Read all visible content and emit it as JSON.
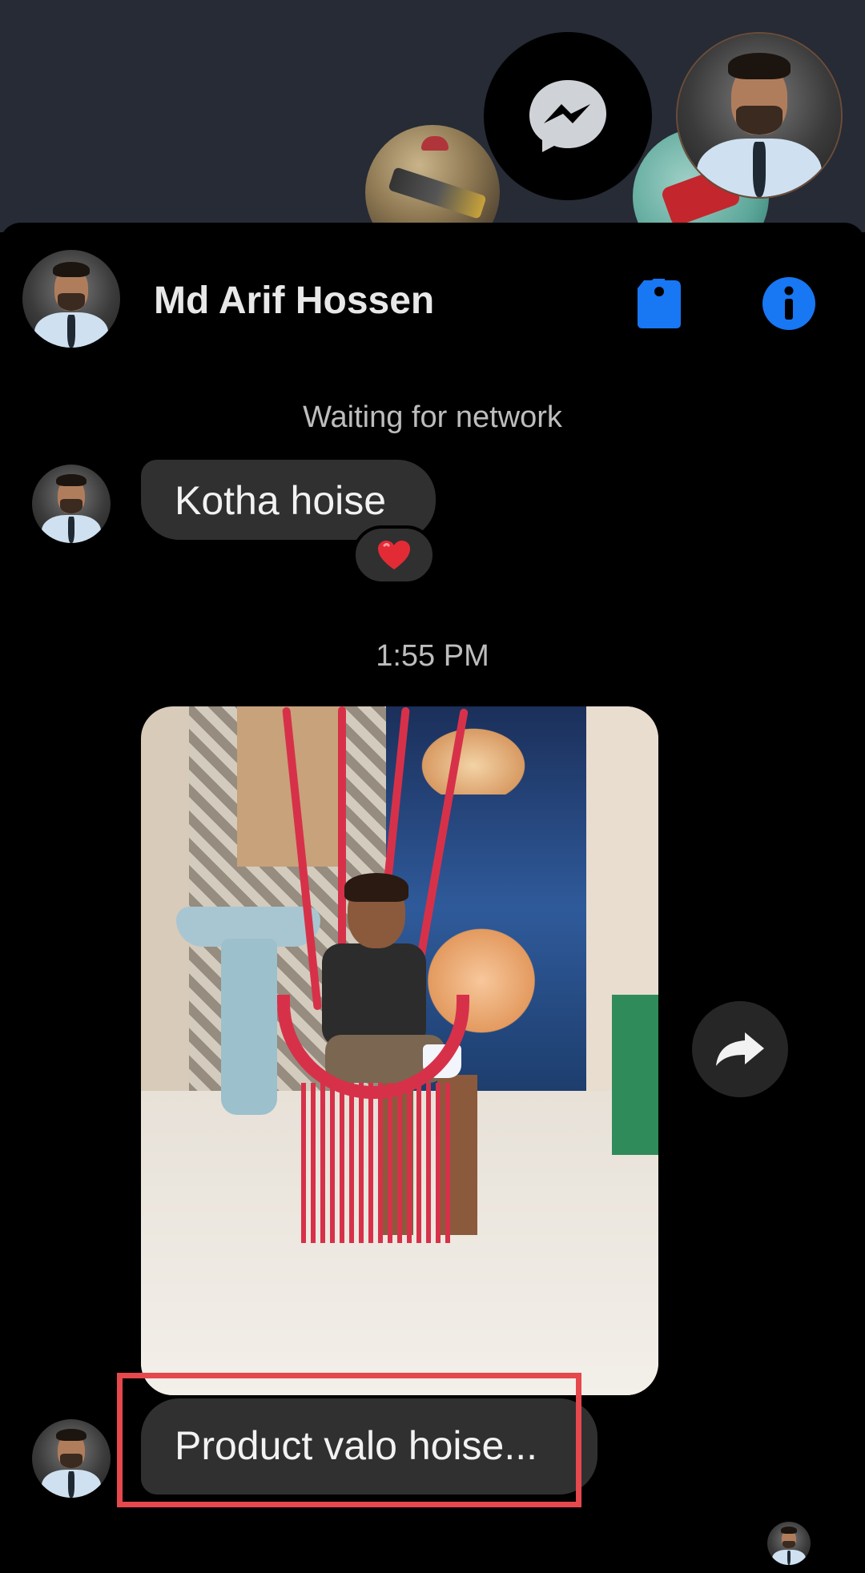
{
  "chat": {
    "contact_name": "Md Arif Hossen",
    "status": "Waiting for network",
    "messages": [
      {
        "text": "Kotha hoise",
        "reaction": "❤️"
      },
      {
        "timestamp": "1:55 PM"
      },
      {
        "type": "photo"
      },
      {
        "text": "Product valo hoise..."
      }
    ]
  },
  "icons": {
    "messenger": "messenger-icon",
    "tag": "tag-icon",
    "info": "info-icon",
    "share": "share-icon"
  },
  "colors": {
    "accent": "#1877f2",
    "bubble": "#303030",
    "highlight": "#e5484d",
    "top_dim": "#262b35"
  }
}
